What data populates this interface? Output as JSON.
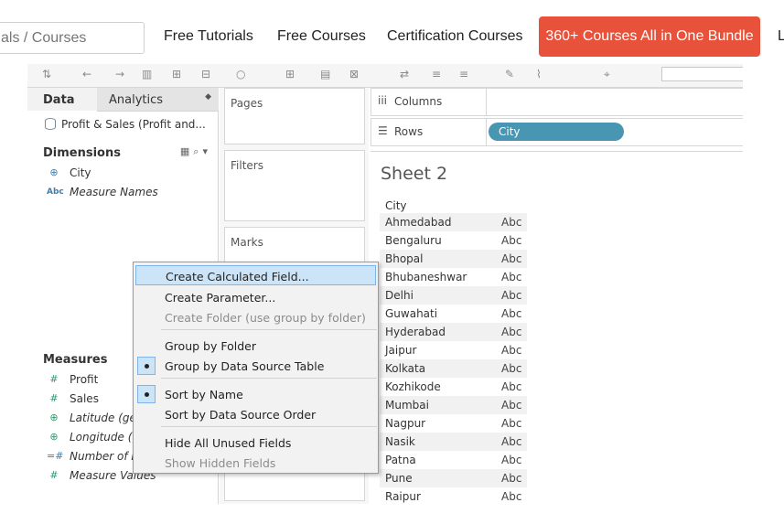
{
  "site_nav": {
    "search_placeholder": "als / Courses",
    "links": [
      "Free Tutorials",
      "Free Courses",
      "Certification Courses"
    ],
    "bundle_button": "360+ Courses All in One Bundle",
    "cut_link": "L",
    "bundle_color": "#e8523a"
  },
  "left_pane": {
    "tab_data": "Data",
    "tab_analytics": "Analytics",
    "datasource": "Profit & Sales (Profit and...",
    "dimensions_header": "Dimensions",
    "dimensions": [
      {
        "icon": "globe-icon",
        "name": "City"
      },
      {
        "icon": "abc-icon",
        "name": "Measure Names"
      }
    ],
    "measures_header": "Measures",
    "measures": [
      {
        "icon": "hash-icon",
        "name": "Profit"
      },
      {
        "icon": "hash-icon",
        "name": "Sales"
      },
      {
        "icon": "globe-icon",
        "name": "Latitude (ge"
      },
      {
        "icon": "globe-icon",
        "name": "Longitude (g"
      },
      {
        "icon": "hash-calc-icon",
        "name": "Number of R"
      },
      {
        "icon": "hash-icon",
        "name": "Measure Values"
      }
    ]
  },
  "cards": {
    "pages": "Pages",
    "filters": "Filters",
    "marks": "Marks"
  },
  "shelves": {
    "columns": "Columns",
    "rows": "Rows",
    "rows_pill": "City",
    "pill_color": "#4996b2"
  },
  "sheet": {
    "title": "Sheet 2",
    "column_header": "City",
    "rows": [
      {
        "city": "Ahmedabad",
        "value": "Abc"
      },
      {
        "city": "Bengaluru",
        "value": "Abc"
      },
      {
        "city": "Bhopal",
        "value": "Abc"
      },
      {
        "city": "Bhubaneshwar",
        "value": "Abc"
      },
      {
        "city": "Delhi",
        "value": "Abc"
      },
      {
        "city": "Guwahati",
        "value": "Abc"
      },
      {
        "city": "Hyderabad",
        "value": "Abc"
      },
      {
        "city": "Jaipur",
        "value": "Abc"
      },
      {
        "city": "Kolkata",
        "value": "Abc"
      },
      {
        "city": "Kozhikode",
        "value": "Abc"
      },
      {
        "city": "Mumbai",
        "value": "Abc"
      },
      {
        "city": "Nagpur",
        "value": "Abc"
      },
      {
        "city": "Nasik",
        "value": "Abc"
      },
      {
        "city": "Patna",
        "value": "Abc"
      },
      {
        "city": "Pune",
        "value": "Abc"
      },
      {
        "city": "Raipur",
        "value": "Abc"
      }
    ]
  },
  "context_menu": {
    "create_calculated_field": "Create Calculated Field...",
    "create_parameter": "Create Parameter...",
    "create_folder": "Create Folder (use group by folder)",
    "group_by_folder": "Group by Folder",
    "group_by_data_source_table": "Group by Data Source Table",
    "sort_by_name": "Sort by Name",
    "sort_by_data_source_order": "Sort by Data Source Order",
    "hide_all_unused_fields": "Hide All Unused Fields",
    "show_hidden_fields": "Show Hidden Fields"
  }
}
